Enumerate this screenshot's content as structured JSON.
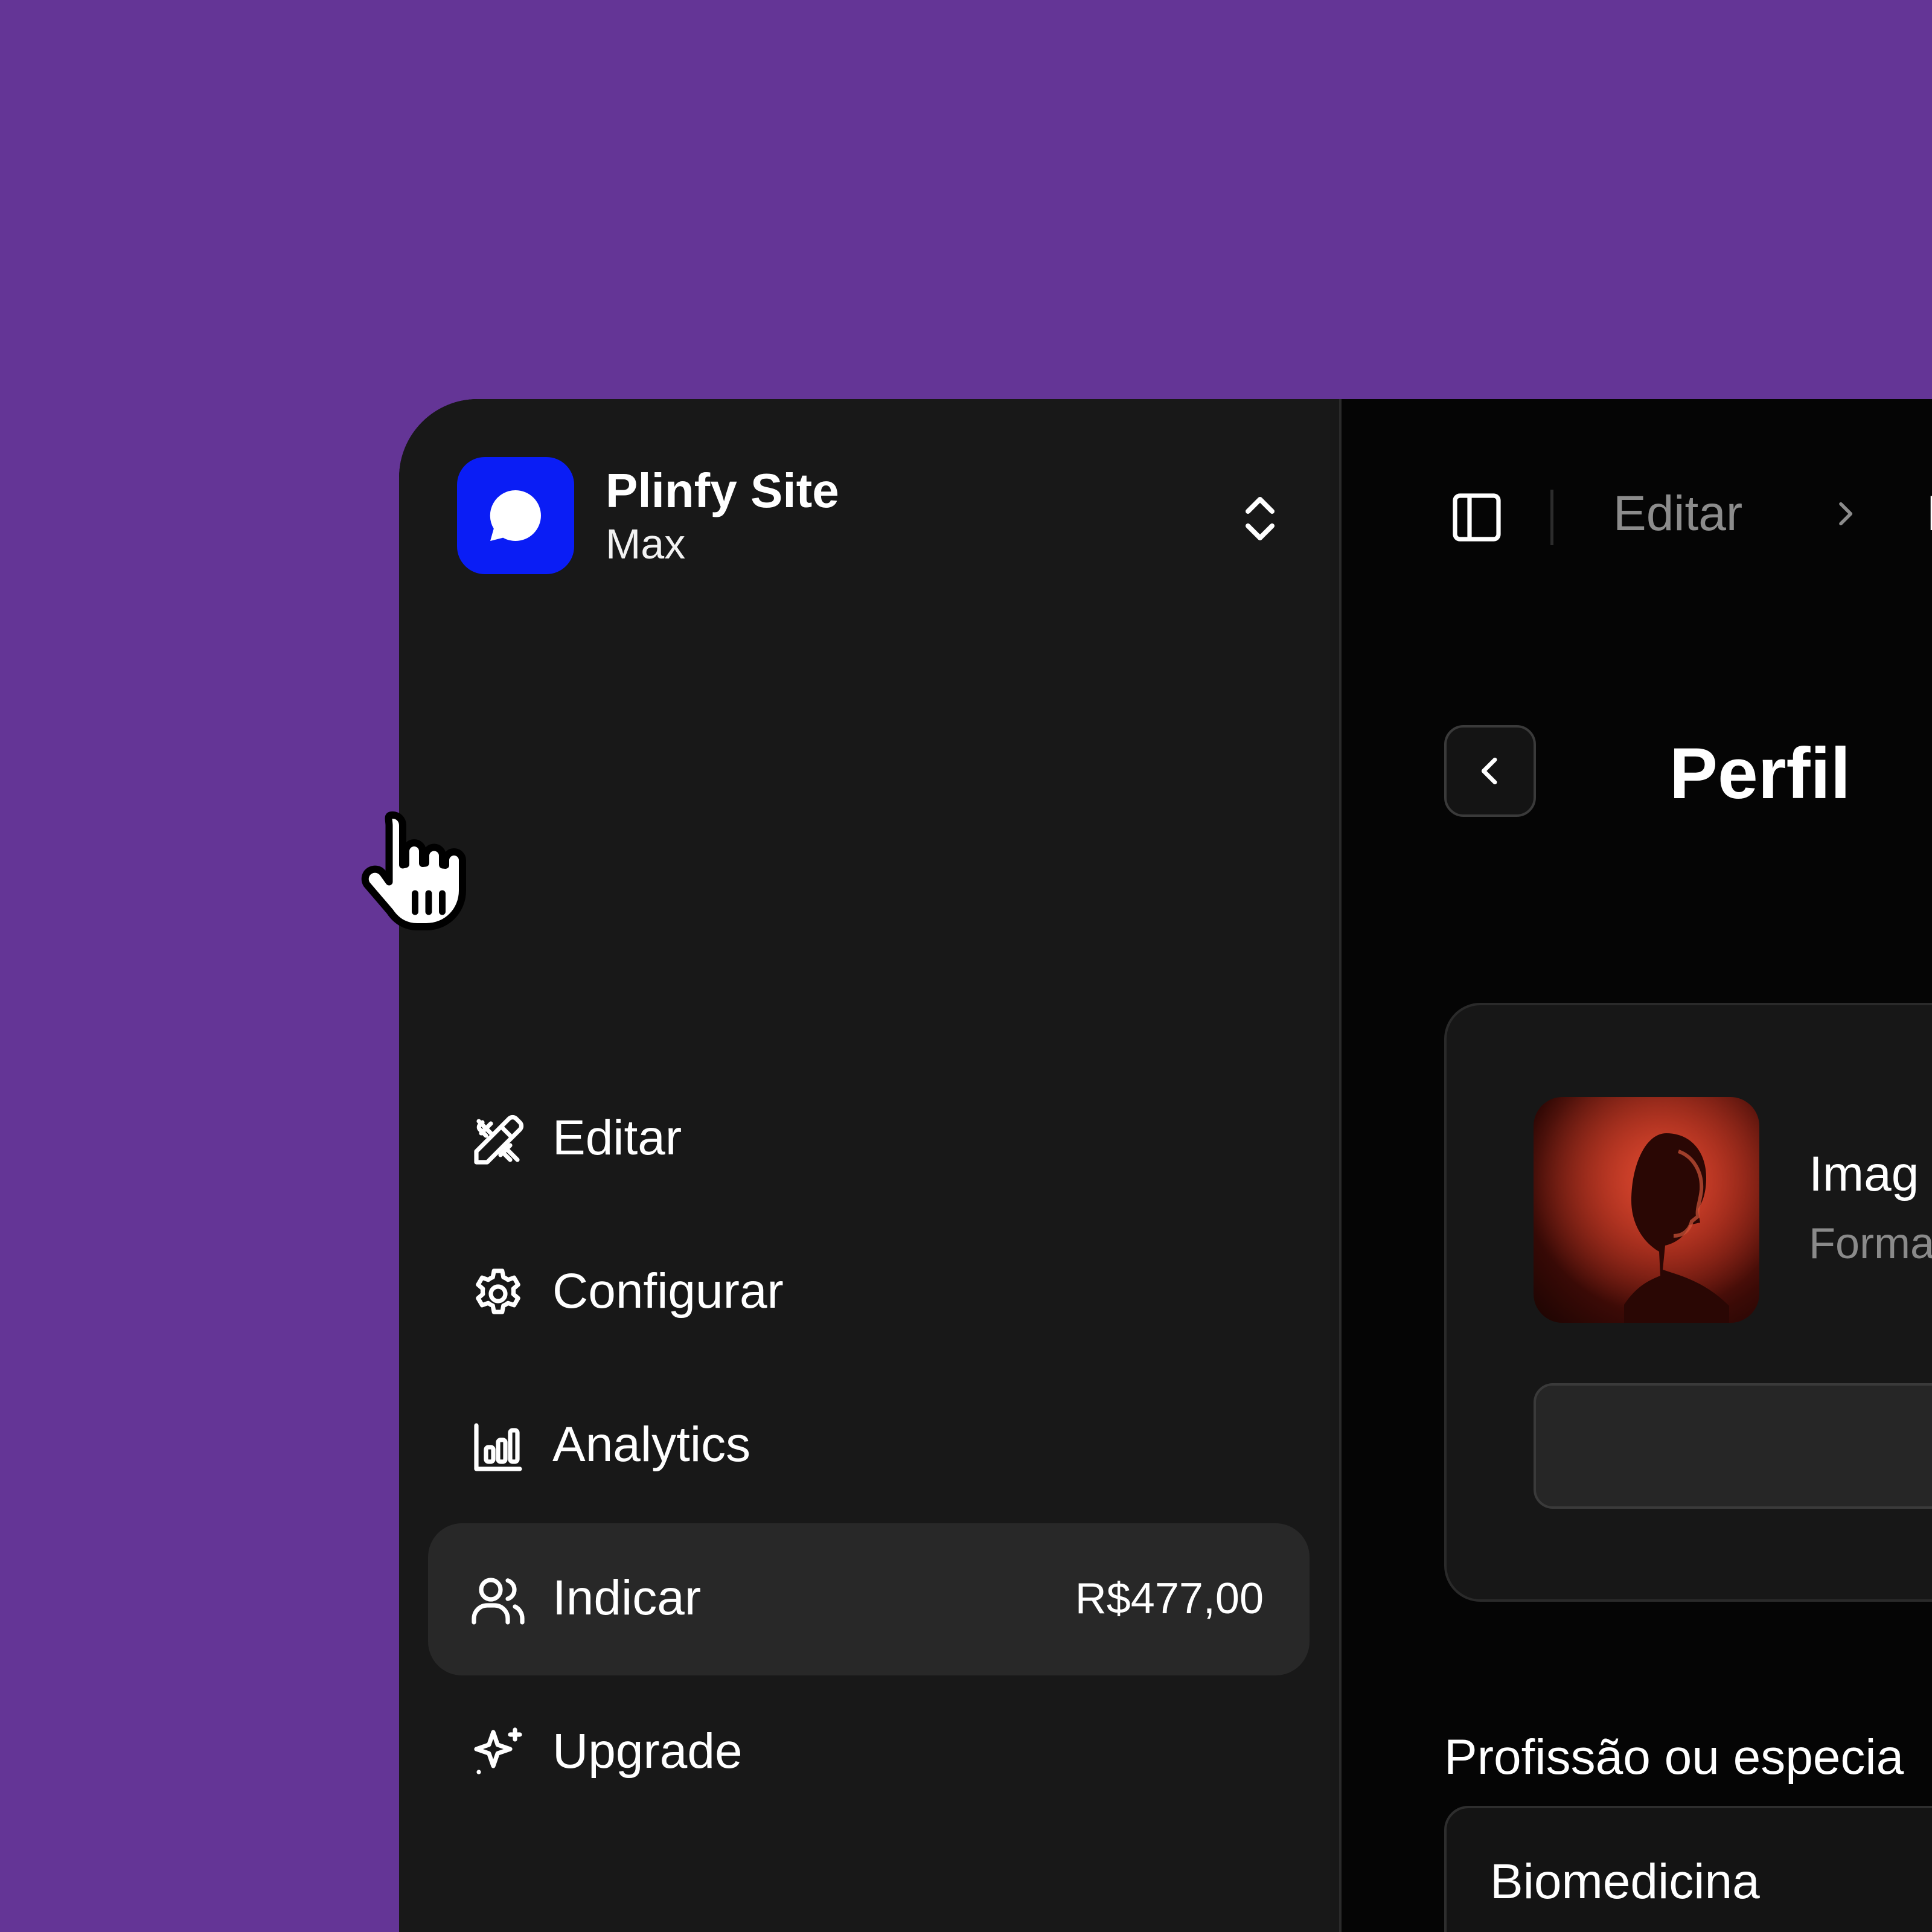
{
  "brand": {
    "title": "Plinfy Site",
    "subtitle": "Max",
    "logo_icon": "chat-bubble-icon",
    "logo_color": "#0a1df5"
  },
  "sidebar": {
    "items": [
      {
        "label": "Editar",
        "icon": "pencil-ruler-icon"
      },
      {
        "label": "Configurar",
        "icon": "gear-icon"
      },
      {
        "label": "Analytics",
        "icon": "bar-chart-icon"
      },
      {
        "label": "Indicar",
        "icon": "users-icon",
        "amount": "R$477,00",
        "active": true
      },
      {
        "label": "Upgrade",
        "icon": "sparkles-icon"
      }
    ]
  },
  "breadcrumb": {
    "items": [
      "Editar",
      "Pe"
    ]
  },
  "page": {
    "title": "Perfil"
  },
  "profile_card": {
    "image_title": "Imag",
    "image_subtitle": "Forma"
  },
  "field": {
    "label": "Profissão ou especia",
    "value": "Biomedicina"
  },
  "colors": {
    "background": "#643596",
    "sidebar": "#181818",
    "main": "#050505",
    "active_item": "#282828"
  }
}
